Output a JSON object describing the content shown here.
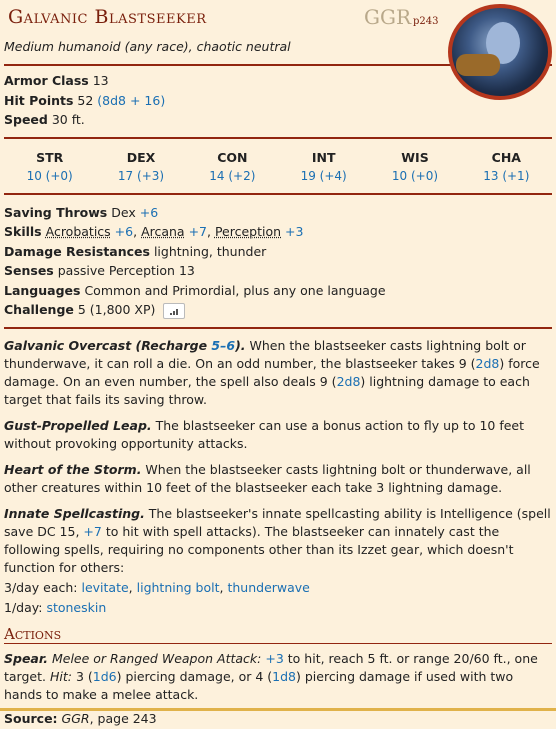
{
  "monster": {
    "name": "Galvanic Blastseeker",
    "source_abbr": "GGR",
    "source_page": "p243",
    "meta": "Medium humanoid (any race), chaotic neutral",
    "avatar": "portrait-image"
  },
  "basics": {
    "ac_label": "Armor Class",
    "ac": "13",
    "hp_label": "Hit Points",
    "hp": "52",
    "hp_dice": "(8d8 + 16)",
    "speed_label": "Speed",
    "speed": "30 ft."
  },
  "abilities": [
    {
      "name": "STR",
      "value": "10 (+0)"
    },
    {
      "name": "DEX",
      "value": "17 (+3)"
    },
    {
      "name": "CON",
      "value": "14 (+2)"
    },
    {
      "name": "INT",
      "value": "19 (+4)"
    },
    {
      "name": "WIS",
      "value": "10 (+0)"
    },
    {
      "name": "CHA",
      "value": "13 (+1)"
    }
  ],
  "details": {
    "saves_label": "Saving Throws",
    "saves_text": "Dex",
    "saves_bonus": "+6",
    "skills_label": "Skills",
    "skill1": "Acrobatics",
    "skill1_bonus": "+6",
    "skill2": "Arcana",
    "skill2_bonus": "+7",
    "skill3": "Perception",
    "skill3_bonus": "+3",
    "resist_label": "Damage Resistances",
    "resist": "lightning, thunder",
    "senses_label": "Senses",
    "senses": "passive Perception 13",
    "lang_label": "Languages",
    "lang": "Common and Primordial, plus any one language",
    "challenge_label": "Challenge",
    "challenge": "5 (1,800 XP)"
  },
  "traits": {
    "t1_name": "Galvanic Overcast (Recharge ",
    "t1_recharge": "5–6",
    "t1_name_end": ").",
    "t1_a": " When the blastseeker casts lightning bolt or thunderwave, it can roll a die. On an odd number, the blastseeker takes 9 (",
    "t1_d1": "2d8",
    "t1_b": ") force damage. On an even number, the spell also deals 9 (",
    "t1_d2": "2d8",
    "t1_c": ") lightning damage to each target that fails its saving throw.",
    "t2_name": "Gust-Propelled Leap.",
    "t2_text": " The blastseeker can use a bonus action to fly up to 10 feet without provoking opportunity attacks.",
    "t3_name": "Heart of the Storm.",
    "t3_text": " When the blastseeker casts lightning bolt or thunderwave, all other creatures within 10 feet of the blastseeker each take 3 lightning damage.",
    "t4_name": "Innate Spellcasting.",
    "t4_a": " The blastseeker's innate spellcasting ability is Intelligence (spell save DC 15, ",
    "t4_bonus": "+7",
    "t4_b": " to hit with spell attacks). The blastseeker can innately cast the following spells, requiring no components other than its Izzet gear, which doesn't function for others:",
    "spells_3_label": "3/day each:",
    "spell_a": "levitate",
    "spell_b": "lightning bolt",
    "spell_c": "thunderwave",
    "spells_1_label": "1/day:",
    "spell_d": "stoneskin"
  },
  "actions": {
    "header": "Actions",
    "a1_name": "Spear.",
    "a1_type": " Melee or Ranged Weapon Attack:",
    "a1_bonus": "+3",
    "a1_a": " to hit, reach 5 ft. or range 20/60 ft., one target.",
    "a1_hit": "Hit:",
    "a1_b": " 3 (",
    "a1_d1": "1d6",
    "a1_c": ") piercing damage, or 4 (",
    "a1_d2": "1d8",
    "a1_d": ") piercing damage if used with two hands to make a melee attack."
  },
  "footer": {
    "source_label": "Source:",
    "source_book": "GGR",
    "source_page": ", page 243"
  },
  "colors": {
    "accent": "#922610",
    "link": "#1a6fb3",
    "background": "#fdf1dc"
  }
}
